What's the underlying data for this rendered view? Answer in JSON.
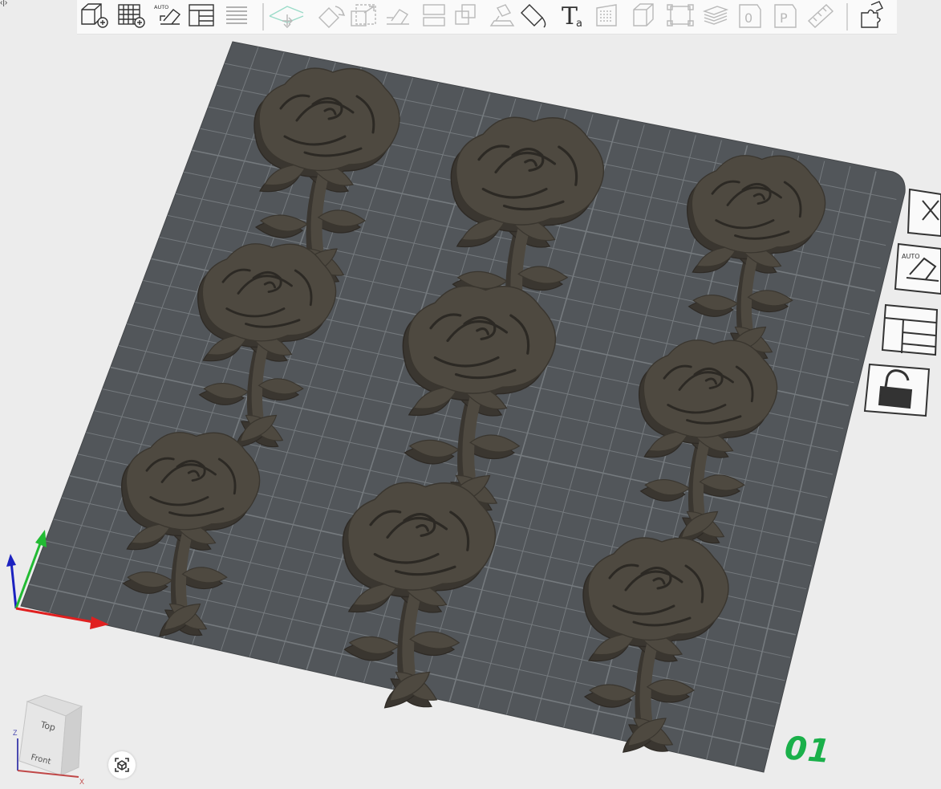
{
  "corner_glyph": "‹|›",
  "toolbar": {
    "items": [
      {
        "name": "add-object",
        "icon": "cube-plus-icon"
      },
      {
        "name": "add-plate",
        "icon": "grid-plus-icon"
      },
      {
        "name": "auto-orient",
        "icon": "auto-orient-icon",
        "label": "AUTO"
      },
      {
        "name": "arrange",
        "icon": "arrange-layout-icon"
      },
      {
        "name": "split-plate",
        "icon": "stripes-icon"
      },
      {
        "name": "move",
        "icon": "move-icon"
      },
      {
        "name": "rotate",
        "icon": "rotate-icon"
      },
      {
        "name": "scale",
        "icon": "scale-icon"
      },
      {
        "name": "lay-on-face",
        "icon": "lay-on-face-icon"
      },
      {
        "name": "cut",
        "icon": "cut-icon"
      },
      {
        "name": "boolean",
        "icon": "boolean-icon"
      },
      {
        "name": "support-paint",
        "icon": "support-paint-icon"
      },
      {
        "name": "color-paint",
        "icon": "paint-bucket-icon"
      },
      {
        "name": "text",
        "icon": "text-icon",
        "label": "T",
        "sublabel": "a"
      },
      {
        "name": "fuzzy-skin",
        "icon": "fuzzy-skin-icon"
      },
      {
        "name": "hollow",
        "icon": "hollow-cube-icon"
      },
      {
        "name": "seam",
        "icon": "seam-icon"
      },
      {
        "name": "layers",
        "icon": "layers-icon"
      },
      {
        "name": "shape-zero",
        "icon": "object-zero-icon",
        "label": "0"
      },
      {
        "name": "shape-p",
        "icon": "object-p-icon",
        "label": "P"
      },
      {
        "name": "measure",
        "icon": "ruler-icon"
      },
      {
        "name": "assembly",
        "icon": "puzzle-icon"
      }
    ]
  },
  "side_toolbar": {
    "items": [
      {
        "name": "delete-plate",
        "icon": "close-icon"
      },
      {
        "name": "auto-orient-plate",
        "icon": "auto-orient-icon",
        "label": "AUTO"
      },
      {
        "name": "arrange-plate",
        "icon": "arrange-layout-icon"
      },
      {
        "name": "lock-plate",
        "icon": "lock-open-icon"
      }
    ]
  },
  "plate": {
    "label": "01",
    "label_color": "#1ab04a",
    "bed_color": "#52565a",
    "grid_color": "#757a7e",
    "model_color": "#4e4940"
  },
  "view_cube": {
    "top": "Top",
    "front": "Front",
    "axis_x": "X",
    "axis_z": "Z"
  },
  "axis_colors": {
    "x": "#e02020",
    "y": "#22bb33",
    "z": "#1c22c0"
  }
}
